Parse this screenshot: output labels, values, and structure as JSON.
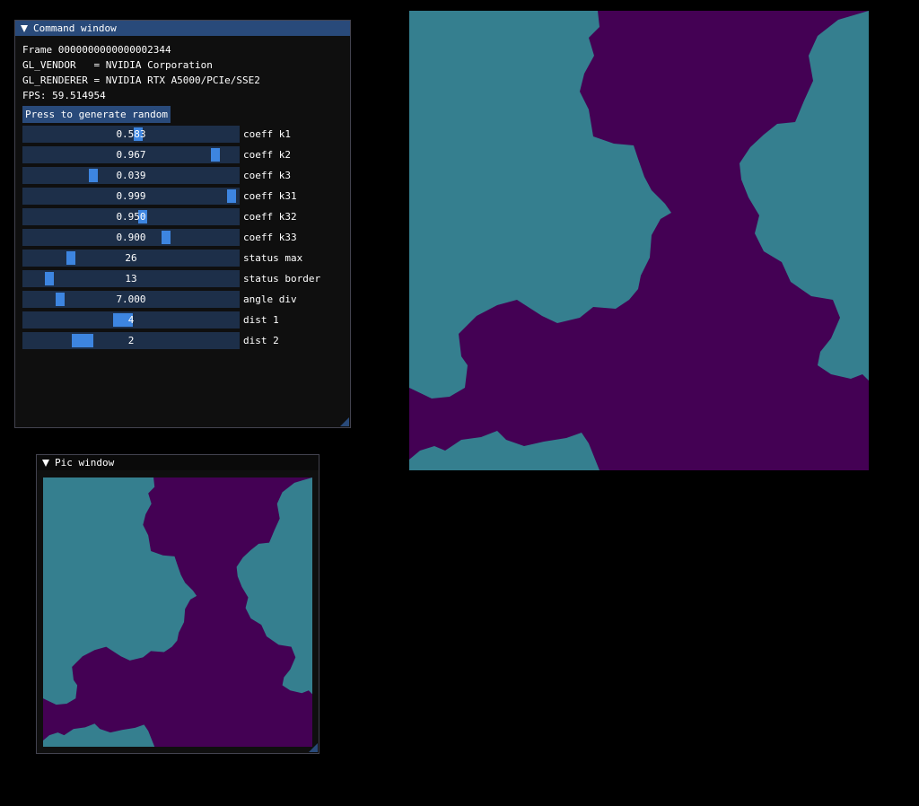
{
  "command_window": {
    "title": "Command window",
    "info_lines": [
      "Frame 0000000000000002344",
      "GL_VENDOR   = NVIDIA Corporation",
      "GL_RENDERER = NVIDIA RTX A5000/PCIe/SSE2",
      "FPS: 59.514954"
    ],
    "random_button_label": "Press to generate random",
    "sliders": [
      {
        "label": "coeff k1",
        "value": "0.583",
        "position": 0.533
      },
      {
        "label": "coeff k2",
        "value": "0.967",
        "position": 0.905
      },
      {
        "label": "coeff k3",
        "value": "0.039",
        "position": 0.319
      },
      {
        "label": "coeff k31",
        "value": "0.999",
        "position": 0.984
      },
      {
        "label": "coeff k32",
        "value": "0.950",
        "position": 0.558
      },
      {
        "label": "coeff k33",
        "value": "0.900",
        "position": 0.666
      },
      {
        "label": "status max",
        "value": "26",
        "position": 0.21
      },
      {
        "label": "status border",
        "value": "13",
        "position": 0.108
      },
      {
        "label": "angle div",
        "value": "7.000",
        "position": 0.158
      },
      {
        "label": "dist 1",
        "value": "4",
        "position": 0.46
      },
      {
        "label": "dist 2",
        "value": "2",
        "position": 0.25
      }
    ]
  },
  "pic_window": {
    "title": "Pic window"
  },
  "colors": {
    "background": "#000000",
    "title_active": "#294a7a",
    "frame_bg": "#1d2f49",
    "slider_grab": "#3d85e0",
    "fractal_purple": "#440154",
    "fractal_teal": "#357f8f"
  }
}
